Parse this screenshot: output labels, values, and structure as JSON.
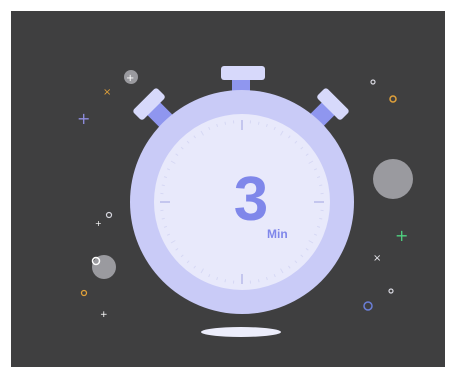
{
  "timer": {
    "value": "3",
    "unit": "Min"
  },
  "colors": {
    "background": "#3f3f40",
    "watch_body": "#c9cbf7",
    "watch_face": "#e8e9fb",
    "accent": "#7f87ea",
    "sparkle_orange": "#e0a13a",
    "sparkle_purple": "#8f8de0",
    "sparkle_green": "#4fd17f",
    "sparkle_blue": "#6b7fd8",
    "orb_gray": "#9a9a9f"
  },
  "icons": [
    "stopwatch-icon",
    "sparkle-icon",
    "orb-icon"
  ]
}
